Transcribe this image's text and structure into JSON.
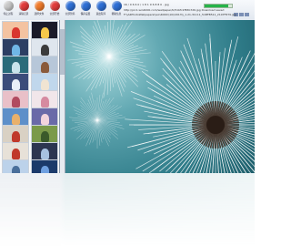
{
  "toolbar": {
    "buttons": [
      {
        "label": "停止过程",
        "color": "#c8c8c8"
      },
      {
        "label": "清除记录",
        "color": "#e23b3b"
      },
      {
        "label": "选择文件",
        "color": "#f07a2a"
      },
      {
        "label": "全部开始",
        "color": "#e23b3b"
      },
      {
        "label": "全部暂停",
        "color": "#2e6fd6"
      },
      {
        "label": "保存设置",
        "color": "#2e6fd6"
      },
      {
        "label": "退出程序",
        "color": "#2e6fd6"
      },
      {
        "label": "帮助信息",
        "color": "#2e6fd6"
      }
    ]
  },
  "info": {
    "line1": "16 / 0 6 6 0 / 1 8 1 9 6 8 8 0 . jpg",
    "line2": "http://pic1.win4000.com/wallpaper/b/51bfc2f83b7d6.jpg  Download saved",
    "line3": "F:\\\\AllPhotoWallpapers\\\\win4000\\\\10\\\\2013\\\\_1.21-31111_51BFB511_2107F879.jpg",
    "progress": 0.85
  },
  "thumbnails": {
    "items": [
      {
        "bg": "#f4c3a1",
        "fig": "#d9362f"
      },
      {
        "bg": "#1a1a28",
        "fig": "#f5c84a"
      },
      {
        "bg": "#2c3e63",
        "fig": "#6fb6e6"
      },
      {
        "bg": "#dfe6ee",
        "fig": "#3b3b3b"
      },
      {
        "bg": "#2a6b7a",
        "fig": "#c8e4ec"
      },
      {
        "bg": "#b7c7d9",
        "fig": "#8a5a3a"
      },
      {
        "bg": "#3b4c7a",
        "fig": "#e9eef7"
      },
      {
        "bg": "#c0d7ec",
        "fig": "#f0e4d2"
      },
      {
        "bg": "#e9c0c8",
        "fig": "#b14a5f"
      },
      {
        "bg": "#f1e6ea",
        "fig": "#d68aa0"
      },
      {
        "bg": "#5d8fc9",
        "fig": "#e9b06a"
      },
      {
        "bg": "#6a6aa8",
        "fig": "#f2d4dc"
      },
      {
        "bg": "#d9d1c4",
        "fig": "#c0392b"
      },
      {
        "bg": "#7b9a4a",
        "fig": "#3a5a2a"
      },
      {
        "bg": "#e7e1d8",
        "fig": "#c0392b"
      },
      {
        "bg": "#2c3550",
        "fig": "#a7c1e0"
      },
      {
        "bg": "#bcd2ea",
        "fig": "#4a6f9a"
      },
      {
        "bg": "#1b3a6a",
        "fig": "#6fa0e0"
      }
    ]
  }
}
